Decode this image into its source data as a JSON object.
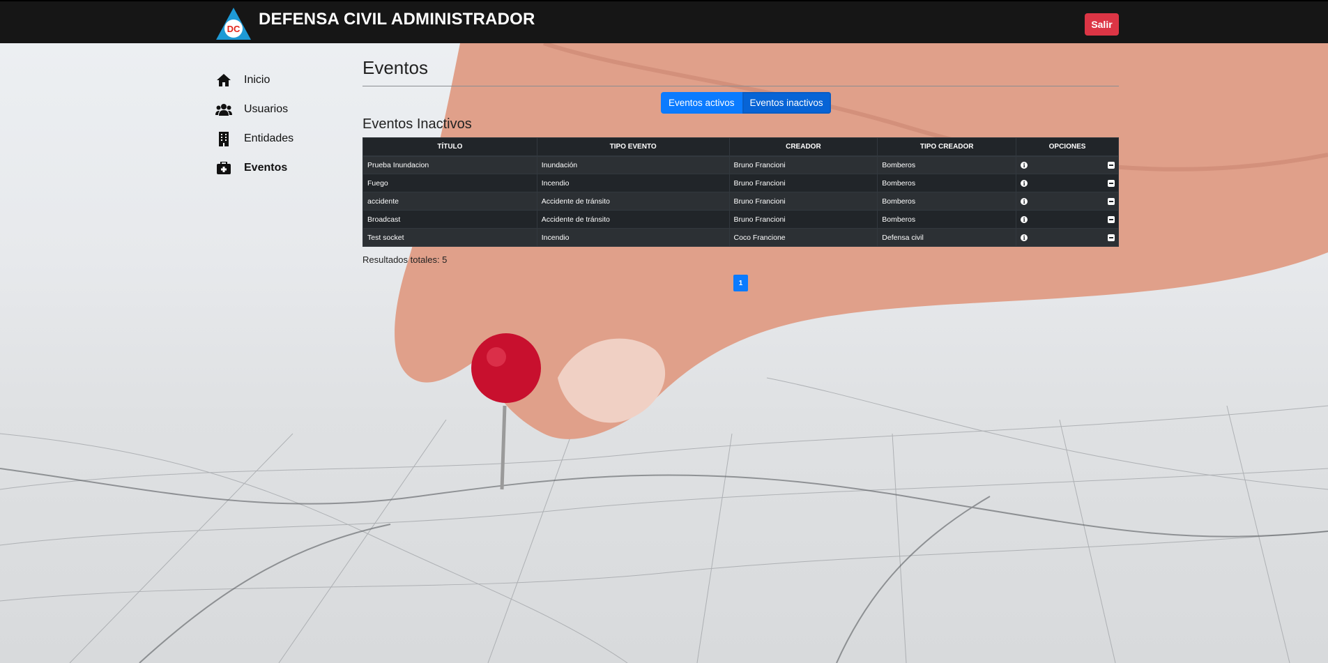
{
  "header": {
    "logo_text": "DC",
    "title": "DEFENSA CIVIL ADMINISTRADOR",
    "logout_label": "Salir"
  },
  "sidebar": {
    "items": [
      {
        "label": "Inicio",
        "icon": "home-icon",
        "active": false
      },
      {
        "label": "Usuarios",
        "icon": "users-icon",
        "active": false
      },
      {
        "label": "Entidades",
        "icon": "building-icon",
        "active": false
      },
      {
        "label": "Eventos",
        "icon": "first-aid-kit-icon",
        "active": true
      }
    ]
  },
  "main": {
    "title": "Eventos",
    "toggle": {
      "active_label": "Eventos activos",
      "inactive_label": "Eventos inactivos",
      "selected": "Eventos inactivos"
    },
    "section_title": "Eventos Inactivos",
    "table": {
      "headers": [
        "TÍTULO",
        "TIPO EVENTO",
        "CREADOR",
        "TIPO CREADOR",
        "OPCIONES"
      ],
      "rows": [
        [
          "Prueba Inundacion",
          "Inundación",
          "Bruno Francioni",
          "Bomberos"
        ],
        [
          "Fuego",
          "Incendio",
          "Bruno Francioni",
          "Bomberos"
        ],
        [
          "accidente",
          "Accidente de tránsito",
          "Bruno Francioni",
          "Bomberos"
        ],
        [
          "Broadcast",
          "Accidente de tránsito",
          "Bruno Francioni",
          "Bomberos"
        ],
        [
          "Test socket",
          "Incendio",
          "Coco Francione",
          "Defensa civil"
        ]
      ],
      "option_icons": [
        "info-icon",
        "remove-icon"
      ]
    },
    "totals": "Resultados totales: 5",
    "pagination": {
      "current_page": "1"
    }
  },
  "colors": {
    "navbar": "#161616",
    "logout": "#dc3545",
    "primary": "#0b7bff",
    "table_bg": "#212529"
  }
}
